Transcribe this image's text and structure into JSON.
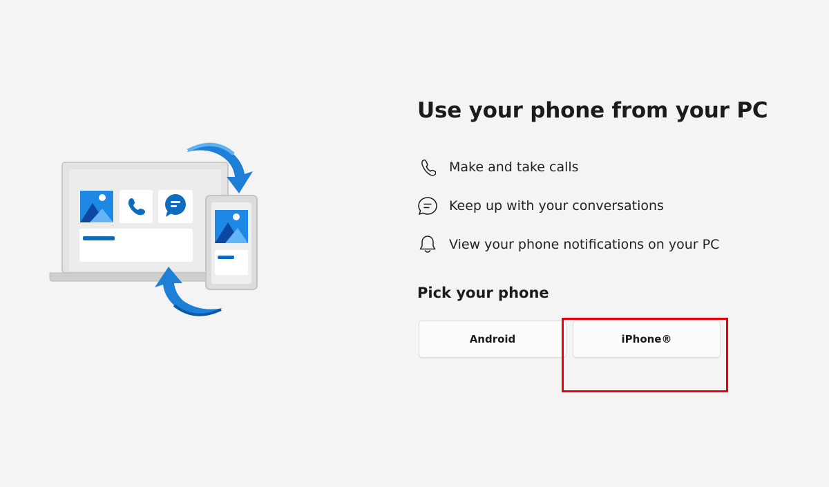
{
  "title": "Use your phone from your PC",
  "features": [
    {
      "icon": "phone-call-icon",
      "label": "Make and take calls"
    },
    {
      "icon": "chat-bubble-icon",
      "label": "Keep up with your conversations"
    },
    {
      "icon": "bell-icon",
      "label": "View your phone notifications on your PC"
    }
  ],
  "pick": {
    "title": "Pick your phone",
    "android_label": "Android",
    "iphone_label": "iPhone®"
  },
  "colors": {
    "accent_blue": "#0f6cbd",
    "highlight_red": "#e8000b",
    "background": "#f4f4f4"
  }
}
